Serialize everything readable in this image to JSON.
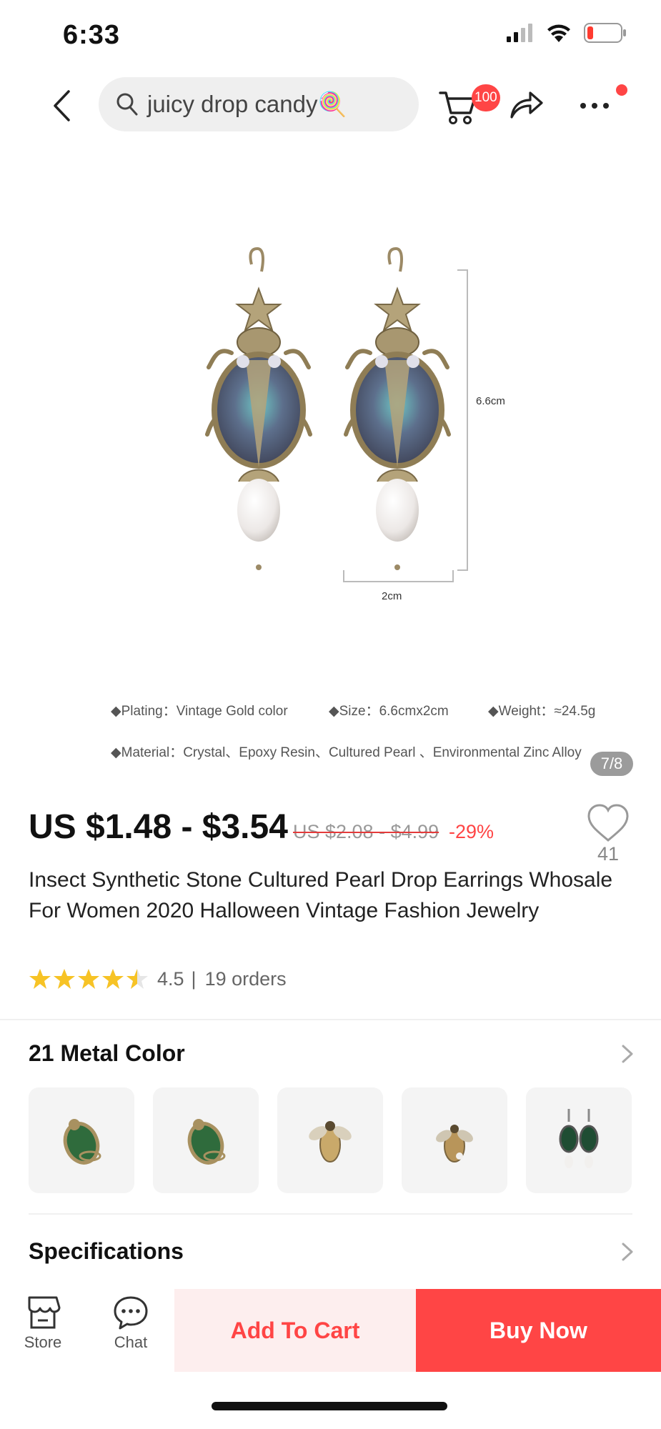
{
  "status_bar": {
    "time": "6:33"
  },
  "nav": {
    "search_query": "juicy drop candy🍭",
    "cart_count": "100"
  },
  "gallery": {
    "dimension_height": "6.6cm",
    "dimension_width": "2cm",
    "specs_line1": [
      "◆Plating：Vintage Gold color",
      "◆Size：6.6cmx2cm",
      "◆Weight：≈24.5g"
    ],
    "specs_line2": "◆Material：Crystal、Epoxy Resin、Cultured Pearl 、Environmental Zinc Alloy",
    "page_indicator": "7/8"
  },
  "product": {
    "price": "US $1.48 - $3.54",
    "original_price": "US $2.08 - $4.99",
    "discount": "-29%",
    "wishlist_count": "41",
    "title": "Insect Synthetic Stone Cultured Pearl Drop Earrings Whosale For Women 2020 Halloween Vintage Fashion Jewelry",
    "rating": 4.5,
    "rating_text": "4.5",
    "orders_text": "19 orders"
  },
  "variants": {
    "title": "21 Metal Color",
    "thumbnails": [
      {
        "icon": "green-beetle-ring"
      },
      {
        "icon": "green-beetle-ring"
      },
      {
        "icon": "bee-brooch"
      },
      {
        "icon": "bee-brooch"
      },
      {
        "icon": "green-beetle-earrings"
      }
    ]
  },
  "specifications": {
    "title": "Specifications"
  },
  "bottom_bar": {
    "store_label": "Store",
    "chat_label": "Chat",
    "add_to_cart_label": "Add To Cart",
    "buy_now_label": "Buy Now"
  },
  "colors": {
    "accent": "#ff4545",
    "star": "#f7c325",
    "add_cart_bg": "#fdeeee"
  }
}
